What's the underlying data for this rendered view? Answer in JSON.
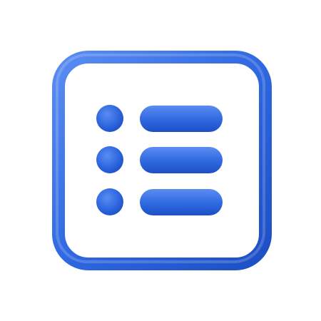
{
  "icon": {
    "name": "list-icon",
    "colors": {
      "primary": "#2f68e0",
      "light": "#5a8cf2",
      "dark": "#1d4fc6",
      "background": "#ffffff"
    },
    "rows": 3
  }
}
